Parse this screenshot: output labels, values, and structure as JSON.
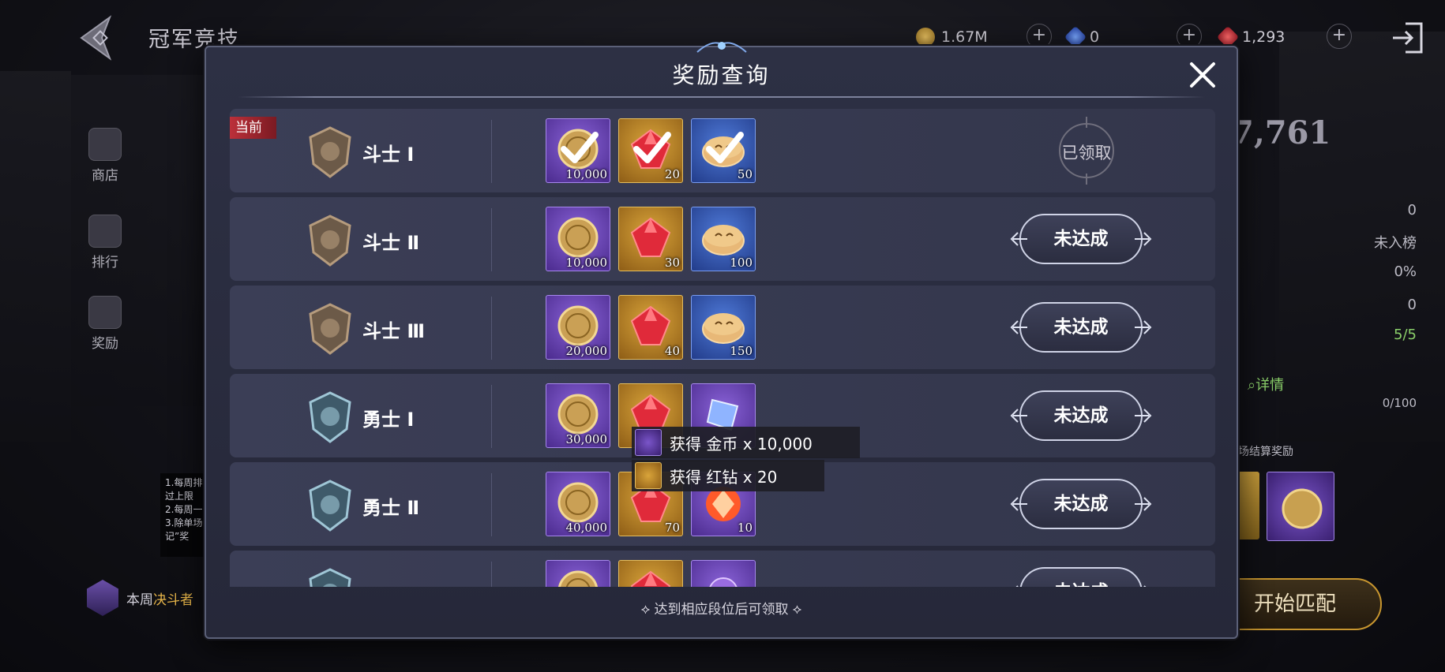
{
  "header": {
    "title": "冠军竞技",
    "gold": "1.67M",
    "blue_gems": "0",
    "red_gems": "1,293"
  },
  "sidebar": {
    "items": [
      {
        "label": "商店"
      },
      {
        "label": "排行"
      },
      {
        "label": "奖励"
      }
    ]
  },
  "background_panel": {
    "score": "7,761",
    "stats": [
      "0",
      "未入榜",
      "0%",
      "0",
      "5/5"
    ],
    "details_link": "详情",
    "progress": "0/100",
    "settlement_label": "场结算奖励",
    "bottom_label_prefix": "本周",
    "bottom_label_highlight": "决斗者",
    "match_button": "开始匹配",
    "rules_text": "1.每周排\n过上限\n2.每周一\n3.除单场\n记”奖"
  },
  "modal": {
    "title": "奖励查询",
    "current_tag": "当前",
    "footer": "达到相应段位后可领取",
    "claimed_label": "已领取",
    "not_reached_label": "未达成",
    "rows": [
      {
        "rank": "斗士 Ⅰ",
        "items": [
          {
            "type": "gold-coin",
            "frame": "purple",
            "qty": "10,000"
          },
          {
            "type": "red-gem",
            "frame": "gold",
            "qty": "20"
          },
          {
            "type": "cookie",
            "frame": "blue",
            "qty": "50"
          }
        ],
        "status": "claimed"
      },
      {
        "rank": "斗士 Ⅱ",
        "items": [
          {
            "type": "gold-coin",
            "frame": "purple",
            "qty": "10,000"
          },
          {
            "type": "red-gem",
            "frame": "gold",
            "qty": "30"
          },
          {
            "type": "cookie",
            "frame": "blue",
            "qty": "100"
          }
        ],
        "status": "not_reached"
      },
      {
        "rank": "斗士 Ⅲ",
        "items": [
          {
            "type": "gold-coin",
            "frame": "purple",
            "qty": "20,000"
          },
          {
            "type": "red-gem",
            "frame": "gold",
            "qty": "40"
          },
          {
            "type": "cookie",
            "frame": "blue",
            "qty": "150"
          }
        ],
        "status": "not_reached"
      },
      {
        "rank": "勇士 Ⅰ",
        "items": [
          {
            "type": "gold-coin",
            "frame": "purple",
            "qty": "30,000"
          },
          {
            "type": "red-gem",
            "frame": "gold",
            "qty": ""
          },
          {
            "type": "crystal",
            "frame": "purple",
            "qty": ""
          }
        ],
        "status": "not_reached"
      },
      {
        "rank": "勇士 Ⅱ",
        "items": [
          {
            "type": "gold-coin",
            "frame": "purple",
            "qty": "40,000"
          },
          {
            "type": "red-gem",
            "frame": "gold",
            "qty": "70"
          },
          {
            "type": "fire-gem",
            "frame": "purple",
            "qty": "10"
          }
        ],
        "status": "not_reached"
      },
      {
        "rank": "",
        "items": [
          {
            "type": "gold-coin",
            "frame": "purple",
            "qty": ""
          },
          {
            "type": "red-gem",
            "frame": "gold",
            "qty": ""
          },
          {
            "type": "orb",
            "frame": "purple",
            "qty": ""
          }
        ],
        "status": "not_reached"
      }
    ]
  },
  "tooltips": [
    {
      "text": "获得 金币 x 10,000",
      "icon": "gold-coin"
    },
    {
      "text": "获得 红钻 x 20",
      "icon": "red-gem"
    }
  ],
  "colors": {
    "accent_red": "#c0313b",
    "btn_border": "#cfd3e6",
    "modal_bg": "#2d3044"
  }
}
